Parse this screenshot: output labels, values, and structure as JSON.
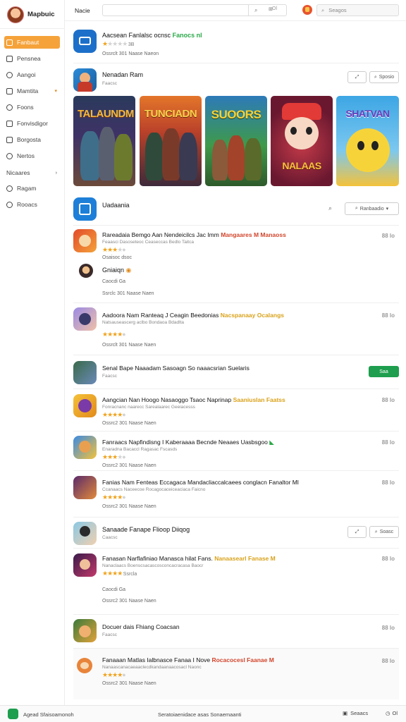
{
  "brand": {
    "name": "Mapbuic"
  },
  "sidebar": {
    "items": [
      {
        "label": "Fanbaut",
        "icon": "home-icon",
        "active": true
      },
      {
        "label": "Pensnea",
        "icon": "grid-icon"
      },
      {
        "label": "Aangoi",
        "icon": "clock-icon"
      },
      {
        "label": "Mamtita",
        "icon": "list-icon"
      },
      {
        "label": "Foons",
        "icon": "user-icon"
      },
      {
        "label": "Fonvisdigor",
        "icon": "book-icon"
      },
      {
        "label": "Borgosta",
        "icon": "folder-icon"
      },
      {
        "label": "Nertos",
        "icon": "settings-icon"
      }
    ],
    "group_label": "Nicaares",
    "group_items": [
      {
        "label": "Ragam",
        "icon": "chat-icon"
      },
      {
        "label": "Rooacs",
        "icon": "star-icon"
      }
    ]
  },
  "topbar": {
    "title": "Nacie",
    "search_placeholder": "",
    "button_label": "Ol",
    "search_label": "Seagos"
  },
  "featured": {
    "title": "Aacsean Fanlalsc ocnsc",
    "badge": "Fanocs nl",
    "meta": "Ossrclt 301 Naase  Naeon",
    "rating_text": "3B"
  },
  "banner": {
    "title": "Nenadan Ram",
    "subtitle": "Faacsc",
    "button_label": "Sposio",
    "cards": [
      {
        "title": "TALAUNDM"
      },
      {
        "title": "TUNCIADN"
      },
      {
        "title": "SUOORS"
      },
      {
        "title": "NALAAS"
      },
      {
        "title": "SHATVAN"
      }
    ]
  },
  "section": {
    "title": "Uadaania",
    "button_label": "Ranbaadio"
  },
  "list": [
    {
      "title": "Rareadaia Bemgo Aan Nendeicilcs Jac Imm",
      "highlight": "Mangaares M Manaoss",
      "hl_color": "red",
      "sub": "Feaasci Dasoseteoc Ceaseccas Bedlo Taitca",
      "stars": 3,
      "meta": "Osaisoc dsoc",
      "num": "88 lo"
    },
    {
      "title": "Gniaiqn",
      "sub": "",
      "stars": 0,
      "meta": "Caocdi Ga",
      "meta2": "Ssrclc 301 Naase  Naen",
      "num": "",
      "sub_row": true
    },
    {
      "title": "Aadoora Nam Ranteaq J Ceagin Beedonias",
      "highlight": "Nacspanaay Ocalangs",
      "hl_color": "yellow",
      "sub": "Natsauseascerg aclbo Bondaoa Bdadlta",
      "stars": 4,
      "meta": "Ossrclt 301 Naase  Naen",
      "num": "88 lo"
    },
    {
      "title": "Senal Bape Naaadam Sasoagn So naaacsrian Suelaris",
      "sub": "Faacsc",
      "stars": 0,
      "meta": "",
      "num": "",
      "green_button": "Saa"
    },
    {
      "title": "Aangcian Nan Hoogo Nasaoggo Tsaoc Naprinap",
      "highlight": "Saaniuslan Faatss",
      "hl_color": "yellow",
      "sub": "Fonracnanc naarecc Sarealaarec Geeiacesss",
      "stars": 4,
      "meta": "Ossrc2 301 Naase  Naen",
      "num": "88 lo"
    },
    {
      "title": "Fanraacs Napfindisng I Kaberaaaa Becnde Neaaes Uasbsgoo",
      "sub": "Enaradna Bacaccl Ragasac Fscasds",
      "stars": 3,
      "meta": "Ossrc2 301 Naase  Naen",
      "num": "88 lo"
    },
    {
      "title": "Fanias Nam Fenteas Eccagaca Mandacliaccalcaees conglacn Fanaltor Ml",
      "sub": "Ccanaacs Naceecoe Rocagocaceiceaciaca Faicno",
      "stars": 4,
      "meta": "Ossrc2 301 Naase  Naen",
      "num": "88 lo"
    }
  ],
  "group2": {
    "title": "Sanaade Fanape Flioop Diiqog",
    "subtitle": "Caacsc",
    "button_label": "Soasc"
  },
  "list2": [
    {
      "title": "Fanasan Narflafiniao Manasca hilat Fans.",
      "highlight": "Nanaasearl Fanase M",
      "hl_color": "yellow",
      "sub": "Nanaclaacs Boenscsacascosconcacracasa Baocr",
      "stars": 4,
      "meta": "Ssrcla",
      "meta_label": "Caocdi Ga",
      "meta2": "Ossrc2 301 Naase  Naen",
      "num": "88 lo"
    },
    {
      "title": "Docuer dais Fhiang Coacsan",
      "sub": "Faacsc",
      "stars": 0,
      "meta": "",
      "num": "88 lo"
    },
    {
      "title": "Fanaaan Matlas Ialbnasce Fanaa I Nove",
      "highlight": "Rocacocesl Faanae M",
      "hl_color": "red",
      "sub": "Nanaascanacaeaaclecdkandaanaacosacl Naonc",
      "stars": 4,
      "meta": "Ossrc2 301 Naase  Naen",
      "num": "88 lo"
    }
  ],
  "footer": {
    "left": "Agead Sfaisoamonoh",
    "center": "Seratoiaenidace asas Sonaemaanti",
    "right1": "Seaacs",
    "right2": "Ol"
  },
  "colors": {
    "accent": "#f5a23a",
    "primary_green": "#1e9e4e",
    "star": "#f0a31c",
    "highlight_red": "#d2452c",
    "highlight_yellow": "#d9a21a"
  }
}
